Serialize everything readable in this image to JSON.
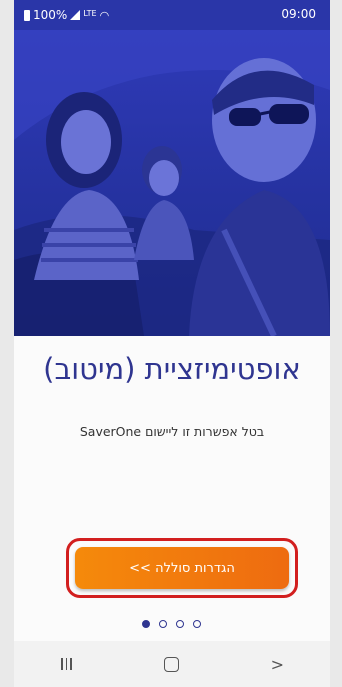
{
  "status_bar": {
    "battery": "100%",
    "network": "LTE",
    "time": "09:00"
  },
  "hero": {
    "image": "family-in-car-photo"
  },
  "content": {
    "title": "אופטימיזציית (מיטוב)",
    "subtitle": "בטל אפשרות זו ליישום SaverOne"
  },
  "cta": {
    "label": "הגדרות סוללה >>"
  },
  "pagination": {
    "total": 4,
    "active_index": 0
  },
  "nav": {
    "recent_icon": "recent-apps-icon",
    "home_icon": "home-icon",
    "back_icon": "back-icon"
  },
  "colors": {
    "hero_overlay": "#2532a0",
    "title": "#2f3590",
    "cta": "#f07812",
    "highlight": "#d21f1f"
  }
}
